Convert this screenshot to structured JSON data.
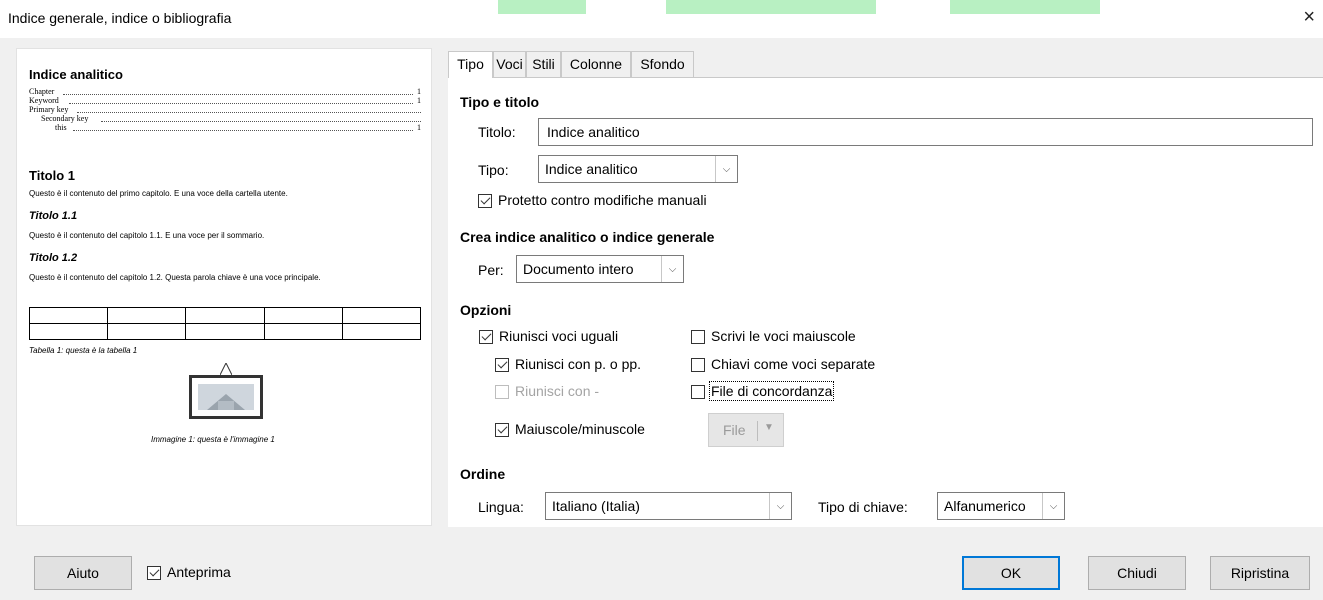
{
  "dialog": {
    "title": "Indice generale, indice o bibliografia",
    "close_glyph": "×"
  },
  "preview": {
    "heading": "Indice analitico",
    "entries": [
      {
        "text": "Chapter",
        "page": "1"
      },
      {
        "text": "Keyword",
        "page": "1"
      },
      {
        "text": "Primary key",
        "page": ""
      },
      {
        "text": "Secondary key",
        "page": ""
      },
      {
        "text": "this",
        "page": "1"
      }
    ],
    "h1": "Titolo 1",
    "p1": "Questo è il contenuto del primo capitolo. E una voce della cartella utente.",
    "h11": "Titolo 1.1",
    "p11": "Questo è il contenuto del capitolo 1.1. E una voce per il sommario.",
    "h12": "Titolo 1.2",
    "p12": "Questo è il contenuto del capitolo 1.2. Questa parola chiave è una voce principale.",
    "table_caption": "Tabella 1: questa è la tabella 1",
    "image_caption": "Immagine 1: questa è l'immagine 1"
  },
  "tabs": [
    "Tipo",
    "Voci",
    "Stili",
    "Colonne",
    "Sfondo"
  ],
  "tipo_titolo": {
    "section": "Tipo e titolo",
    "titolo_label": "Titolo:",
    "titolo_value": "Indice analitico",
    "tipo_label": "Tipo:",
    "tipo_value": "Indice analitico",
    "protetto_label": "Protetto contro modifiche manuali",
    "protetto_checked": true
  },
  "crea": {
    "section": "Crea indice analitico o indice generale",
    "per_label": "Per:",
    "per_value": "Documento intero"
  },
  "opzioni": {
    "section": "Opzioni",
    "riunisci_voci": {
      "label": "Riunisci voci uguali",
      "checked": true
    },
    "riunisci_pp": {
      "label": "Riunisci con p. o pp.",
      "checked": true
    },
    "riunisci_con": {
      "label": "Riunisci con -",
      "checked": false,
      "disabled": true
    },
    "maiuscole": {
      "label": "Maiuscole/minuscole",
      "checked": true
    },
    "scrivi_maiuscole": {
      "label": "Scrivi le voci maiuscole",
      "checked": false
    },
    "chiavi_separate": {
      "label": "Chiavi come voci separate",
      "checked": false
    },
    "file_concordanza": {
      "label": "File di concordanza",
      "checked": false
    },
    "file_button": "File"
  },
  "ordine": {
    "section": "Ordine",
    "lingua_label": "Lingua:",
    "lingua_value": "Italiano (Italia)",
    "chiave_label": "Tipo di chiave:",
    "chiave_value": "Alfanumerico"
  },
  "footer": {
    "aiuto": "Aiuto",
    "anteprima": "Anteprima",
    "anteprima_checked": true,
    "ok": "OK",
    "chiudi": "Chiudi",
    "ripristina": "Ripristina"
  },
  "colors": {
    "accent": "#0078d7",
    "dialog_bg": "#f0f0f0",
    "green_overlay": "#b8f0c2"
  }
}
